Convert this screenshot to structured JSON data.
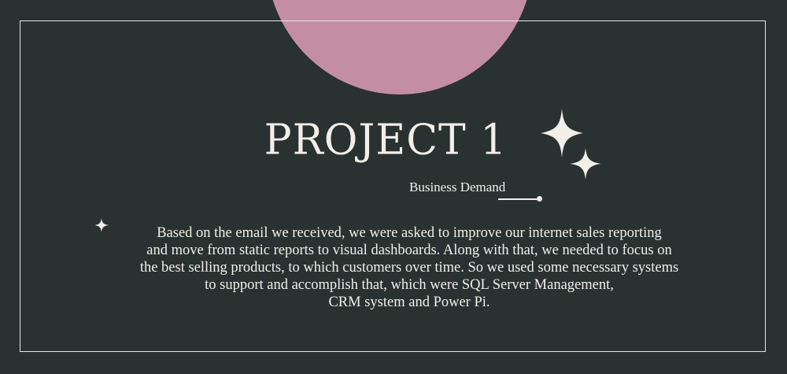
{
  "colors": {
    "background": "#293230",
    "accent_circle": "#c48ea2",
    "text": "#f2efe8",
    "frame": "#e9e6df"
  },
  "header": {
    "title": "PROJECT 1",
    "subtitle": "Business Demand"
  },
  "body": {
    "lines": [
      "Based on the email we received, we were asked to improve our internet sales reporting",
      "and move from static reports to visual dashboards. Along with that, we needed to focus on",
      "the best selling products, to which customers over time. So we used some necessary systems",
      "to support and accomplish that, which were SQL Server Management,",
      "CRM system and Power Pi."
    ]
  },
  "icons": {
    "decoration": [
      "sparkle-icon",
      "sparkle-small-icon",
      "sparkle-bullet-icon"
    ]
  }
}
